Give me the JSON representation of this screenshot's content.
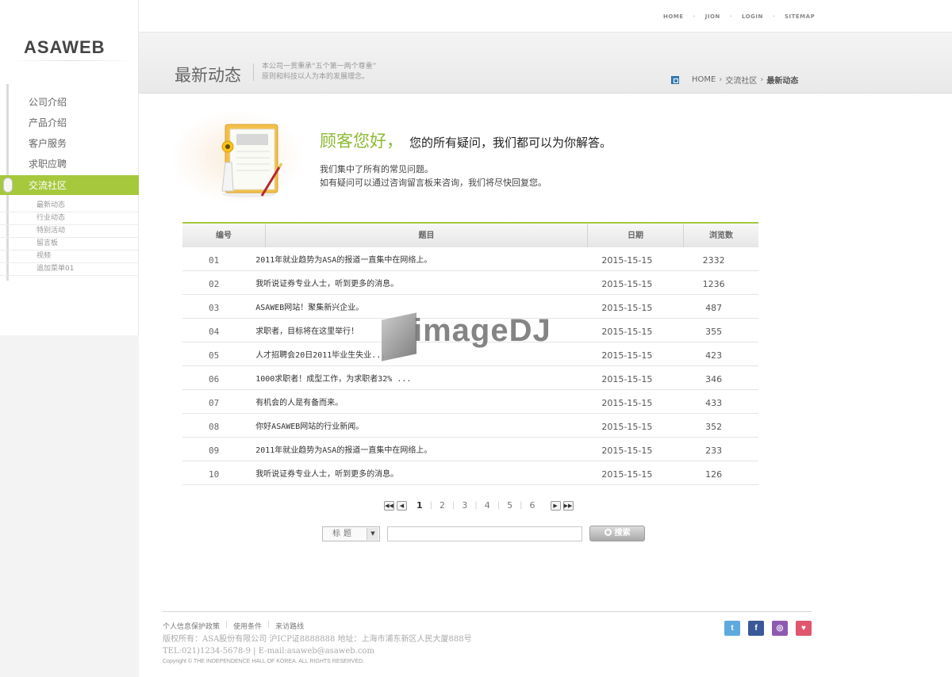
{
  "top_links": [
    "HOME",
    "JION",
    "LOGIN",
    "SITEMAP"
  ],
  "logo": "ASAWEB",
  "sidebar": {
    "items": [
      {
        "label": "公司介绍"
      },
      {
        "label": "产品介绍"
      },
      {
        "label": "客户服务"
      },
      {
        "label": "求职应聘"
      },
      {
        "label": "交流社区",
        "active": true
      }
    ],
    "sub_items": [
      {
        "label": "最新动态"
      },
      {
        "label": "行业动态"
      },
      {
        "label": "特别活动"
      },
      {
        "label": "留言板"
      },
      {
        "label": "视频"
      },
      {
        "label": "追加菜单01"
      }
    ]
  },
  "header": {
    "title": "最新动态",
    "slogan_line1": "本公司一贯秉承“五个第一两个尊重”",
    "slogan_line2": "原则和科技以人为本的发展理念。",
    "breadcrumb": {
      "home": "HOME",
      "level1": "交流社区",
      "current": "最新动态"
    }
  },
  "intro": {
    "heading_green": "顾客您好，",
    "heading_black": "您的所有疑问，我们都可以为你解答。",
    "line1": "我们集中了所有的常见问题。",
    "line2": "如有疑问可以通过咨询留言板来咨询，我们将尽快回复您。"
  },
  "table": {
    "headers": {
      "no": "编号",
      "title": "题目",
      "date": "日期",
      "views": "浏览数"
    },
    "rows": [
      {
        "no": "01",
        "title": "2011年就业趋势为ASA的报道一直集中在网络上。",
        "date": "2015-15-15",
        "views": "2332"
      },
      {
        "no": "02",
        "title": "我听说证券专业人士，听到更多的消息。",
        "date": "2015-15-15",
        "views": "1236"
      },
      {
        "no": "03",
        "title": "ASAWEB网站！聚集新兴企业。",
        "date": "2015-15-15",
        "views": "487"
      },
      {
        "no": "04",
        "title": "求职者，目标将在这里举行！",
        "date": "2015-15-15",
        "views": "355"
      },
      {
        "no": "05",
        "title": "人才招聘会20日2011毕业生失业...",
        "date": "2015-15-15",
        "views": "423"
      },
      {
        "no": "06",
        "title": "1000求职者！成型工作，为求职者32% ...",
        "date": "2015-15-15",
        "views": "346"
      },
      {
        "no": "07",
        "title": "有机会的人是有备而来。",
        "date": "2015-15-15",
        "views": "433"
      },
      {
        "no": "08",
        "title": "你好ASAWEB网站的行业新闻。",
        "date": "2015-15-15",
        "views": "352"
      },
      {
        "no": "09",
        "title": "2011年就业趋势为ASA的报道一直集中在网络上。",
        "date": "2015-15-15",
        "views": "233"
      },
      {
        "no": "10",
        "title": "我听说证券专业人士，听到更多的消息。",
        "date": "2015-15-15",
        "views": "126"
      }
    ]
  },
  "watermark": "imageDJ",
  "pagination": {
    "pages": [
      "1",
      "2",
      "3",
      "4",
      "5",
      "6"
    ],
    "current": "1"
  },
  "search": {
    "field_select": "标题",
    "input_value": "",
    "button_label": "搜索"
  },
  "footer": {
    "links": [
      "个人信息保护政策",
      "使用条件",
      "来访路线"
    ],
    "copyright": "版权所有：ASA股份有限公司 沪ICP证8888888 地址：上海市浦东新区人民大厦888号",
    "contact": "TEL:021)1234-5678-9 | E-mail:asaweb@asaweb.com",
    "small": "Copyright © THE INDEPENDENCE HALL OF KOREA. ALL RIGHTS RESERVED."
  },
  "colors": {
    "accent_green": "#a6c83d",
    "heading_green": "#8bbb32"
  }
}
